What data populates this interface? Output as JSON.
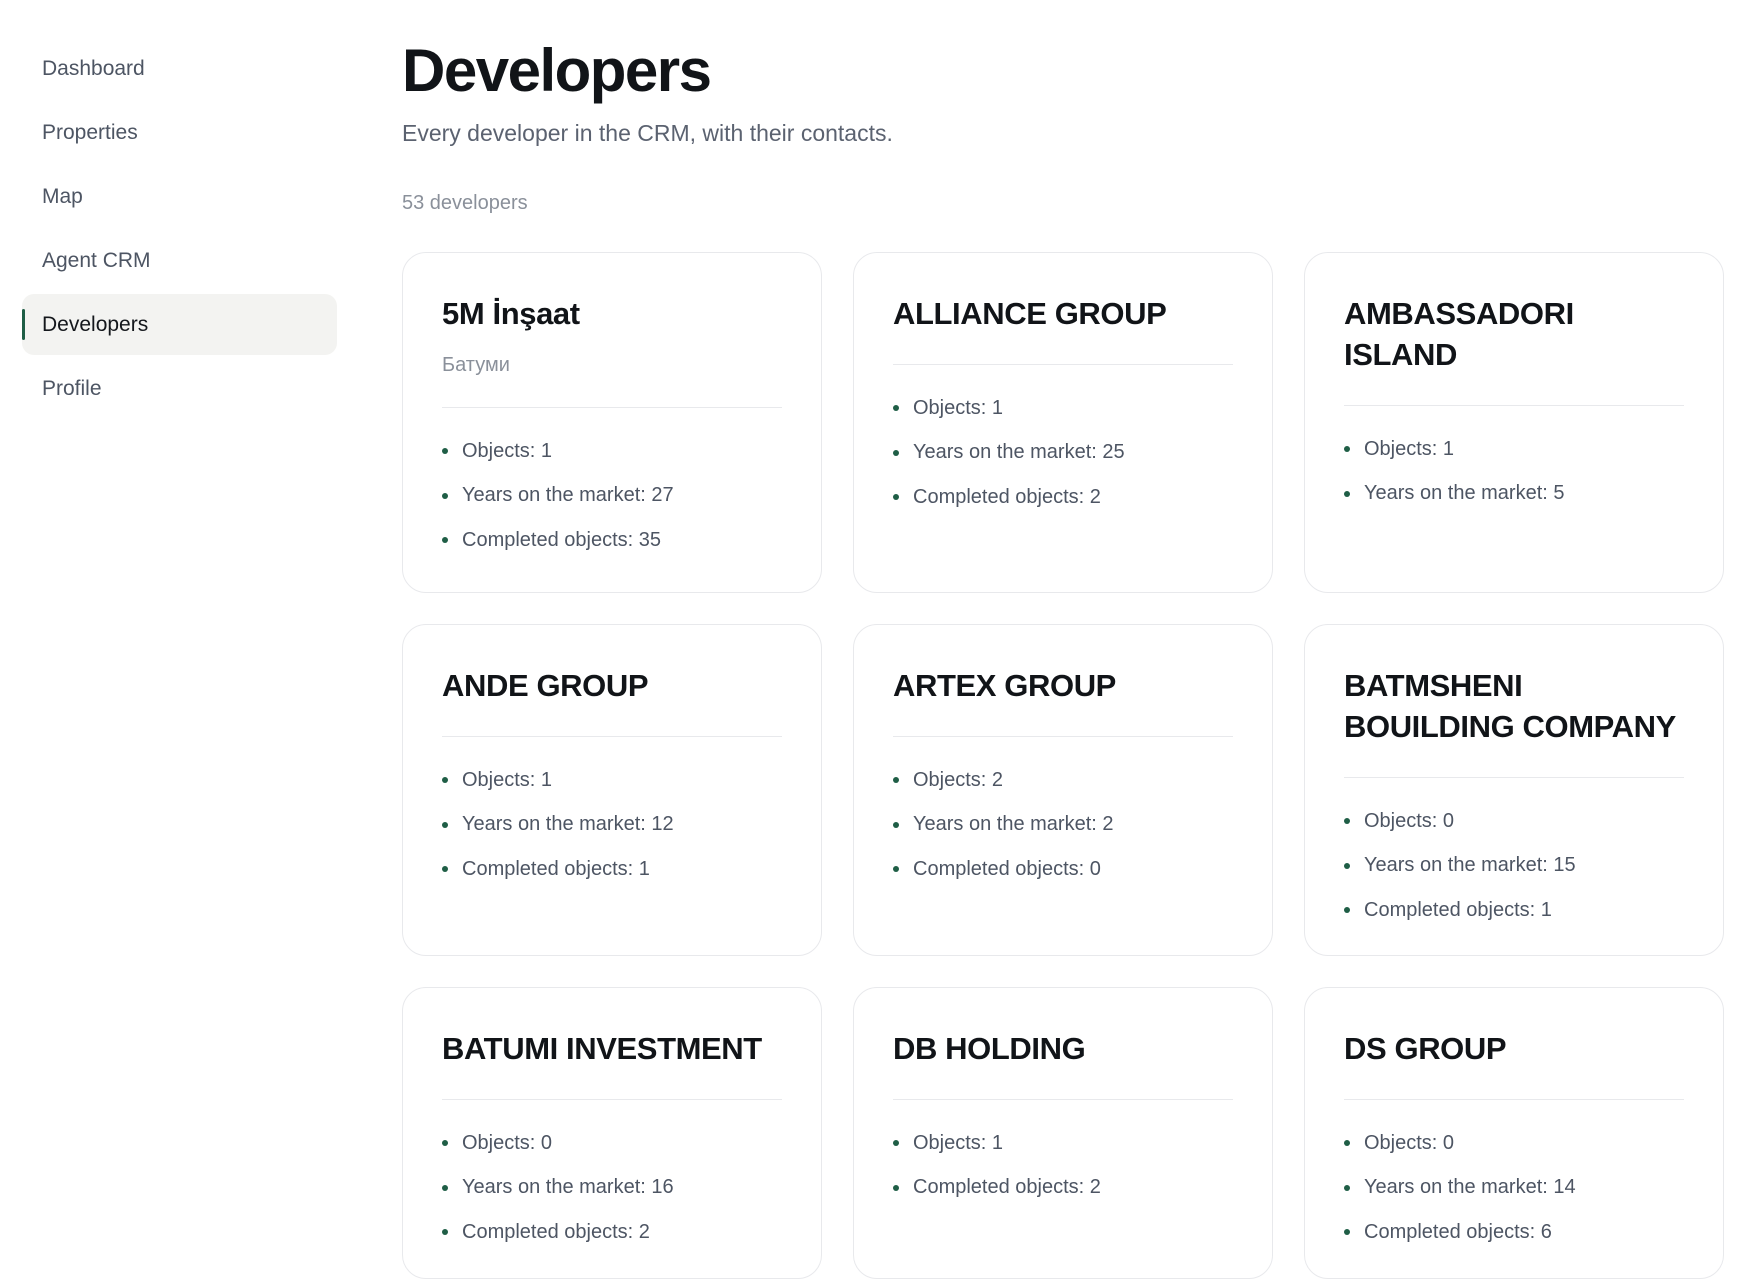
{
  "sidebar": {
    "items": [
      {
        "label": "Dashboard"
      },
      {
        "label": "Properties"
      },
      {
        "label": "Map"
      },
      {
        "label": "Agent CRM"
      },
      {
        "label": "Developers",
        "active": true
      },
      {
        "label": "Profile"
      }
    ]
  },
  "header": {
    "title": "Developers",
    "subtitle": "Every developer in the CRM, with their contacts.",
    "count": "53 developers"
  },
  "labels": {
    "objects": "Objects:",
    "years": "Years on the market:",
    "completed": "Completed objects:"
  },
  "developers": [
    {
      "name": "5M İnşaat",
      "city": "Батуми",
      "objects": "1",
      "years": "27",
      "completed": "35"
    },
    {
      "name": "ALLIANCE GROUP",
      "objects": "1",
      "years": "25",
      "completed": "2"
    },
    {
      "name": "AMBASSADORI ISLAND",
      "objects": "1",
      "years": "5"
    },
    {
      "name": "ANDE GROUP",
      "objects": "1",
      "years": "12",
      "completed": "1"
    },
    {
      "name": "ARTEX GROUP",
      "objects": "2",
      "years": "2",
      "completed": "0"
    },
    {
      "name": "BATMSHENI BOUILDING COMPANY",
      "objects": "0",
      "years": "15",
      "completed": "1"
    },
    {
      "name": "BATUMI INVESTMENT",
      "objects": "0",
      "years": "16",
      "completed": "2"
    },
    {
      "name": "DB HOLDING",
      "objects": "1",
      "completed": "2"
    },
    {
      "name": "DS GROUP",
      "objects": "0",
      "years": "14",
      "completed": "6"
    }
  ],
  "colors": {
    "accent": "#1f5e46",
    "active_nav_bg": "#f3f3f1",
    "muted_text": "#4d5563"
  }
}
